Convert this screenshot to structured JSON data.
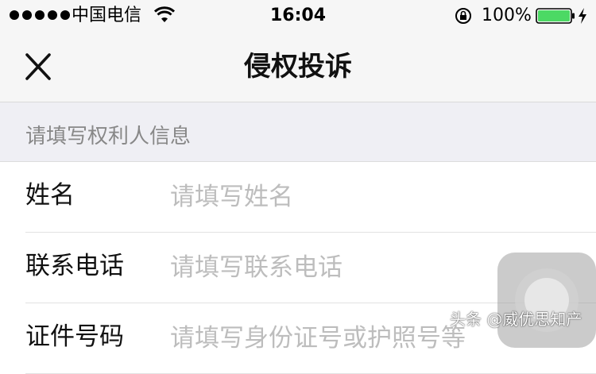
{
  "status_bar": {
    "carrier": "中国电信",
    "time": "16:04",
    "battery_percent": "100%",
    "icons": {
      "signal": "signal-dots-icon",
      "wifi": "wifi-icon",
      "orientation_lock": "lock-icon",
      "battery": "battery-icon",
      "charging": "charge-icon"
    }
  },
  "nav": {
    "title": "侵权投诉",
    "close_icon": "close-icon"
  },
  "section": {
    "header": "请填写权利人信息"
  },
  "form": {
    "fields": [
      {
        "label": "姓名",
        "placeholder": "请填写姓名",
        "value": ""
      },
      {
        "label": "联系电话",
        "placeholder": "请填写联系电话",
        "value": ""
      },
      {
        "label": "证件号码",
        "placeholder": "请填写身份证号或护照号等",
        "value": ""
      }
    ]
  },
  "watermark": "头条 @威优思知产",
  "colors": {
    "bar_background": "#f6f6f6",
    "section_background": "#efeff4",
    "placeholder": "#bdbdbd",
    "battery_green": "#4cd964"
  }
}
